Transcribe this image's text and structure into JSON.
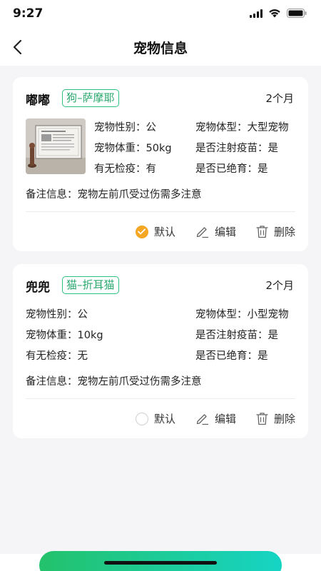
{
  "status_bar": {
    "time": "9:27"
  },
  "header": {
    "title": "宠物信息"
  },
  "pets": [
    {
      "name": "嘟嘟",
      "breed": "狗–萨摩耶",
      "age": "2个月",
      "gender": "宠物性别：公",
      "size": "宠物体型：大型宠物",
      "weight": "宠物体重：50kg",
      "vaccinated": "是否注射疫苗：是",
      "quarantine": "有无检疫：有",
      "sterilized": "是否已绝育：是",
      "remark": "备注信息：宠物左前爪受过伤需多注意",
      "is_default": true,
      "has_photo": true
    },
    {
      "name": "兜兜",
      "breed": "猫–折耳猫",
      "age": "2个月",
      "gender": "宠物性别：公",
      "size": "宠物体型：小型宠物",
      "weight": "宠物体重：10kg",
      "vaccinated": "是否注射疫苗：是",
      "quarantine": "有无检疫：无",
      "sterilized": "是否已绝育：是",
      "remark": "备注信息：宠物左前爪受过伤需多注意",
      "is_default": false,
      "has_photo": false
    }
  ],
  "actions": {
    "default_label": "默认",
    "edit_label": "编辑",
    "delete_label": "删除"
  },
  "colors": {
    "accent_green": "#2ec27e",
    "default_orange": "#f5a623"
  }
}
